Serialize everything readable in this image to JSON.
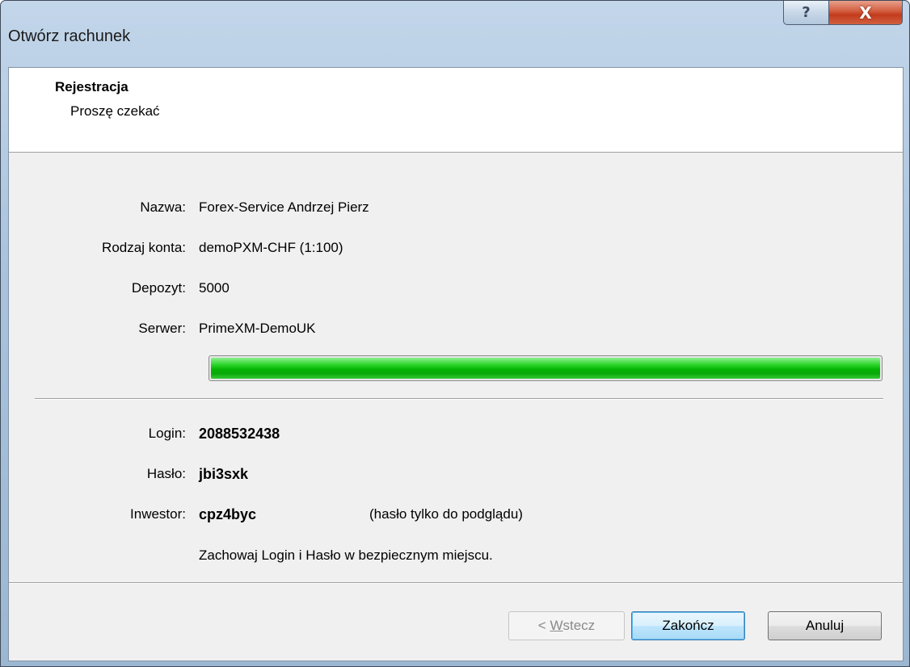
{
  "window": {
    "title": "Otwórz rachunek",
    "help_glyph": "?",
    "close_glyph": "X"
  },
  "header": {
    "title": "Rejestracja",
    "subtitle": "Proszę czekać"
  },
  "account": {
    "name_label": "Nazwa:",
    "name_value": "Forex-Service Andrzej Pierz",
    "type_label": "Rodzaj konta:",
    "type_value": "demoPXM-CHF (1:100)",
    "deposit_label": "Depozyt:",
    "deposit_value": "5000",
    "server_label": "Serwer:",
    "server_value": "PrimeXM-DemoUK"
  },
  "progress": {
    "percent": 100,
    "color": "#06b406"
  },
  "credentials": {
    "login_label": "Login:",
    "login_value": "2088532438",
    "password_label": "Hasło:",
    "password_value": "jbi3sxk",
    "investor_label": "Inwestor:",
    "investor_value": "cpz4byc",
    "investor_note": "(hasło tylko do podglądu)",
    "notice": "Zachowaj Login i Hasło w bezpiecznym miejscu."
  },
  "buttons": {
    "back_prefix": "< ",
    "back_accel": "W",
    "back_rest": "stecz",
    "finish": "Zakończ",
    "cancel": "Anuluj"
  }
}
